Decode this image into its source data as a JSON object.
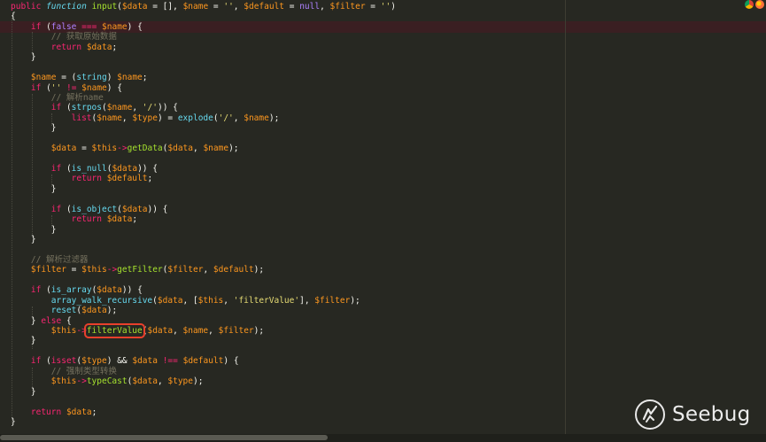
{
  "editor": {
    "theme": "monokai",
    "highlight_color": "#3a1f22",
    "annotation_color": "#e8402c",
    "lines": [
      [
        [
          "k",
          "public"
        ],
        [
          "p",
          " "
        ],
        [
          "st",
          "function"
        ],
        [
          "p",
          " "
        ],
        [
          "fn",
          "input"
        ],
        [
          "p",
          "("
        ],
        [
          "v",
          "$data"
        ],
        [
          "p",
          " = [], "
        ],
        [
          "v",
          "$name"
        ],
        [
          "p",
          " = "
        ],
        [
          "s",
          "''"
        ],
        [
          "p",
          ", "
        ],
        [
          "v",
          "$default"
        ],
        [
          "p",
          " = "
        ],
        [
          "cn",
          "null"
        ],
        [
          "p",
          ", "
        ],
        [
          "v",
          "$filter"
        ],
        [
          "p",
          " = "
        ],
        [
          "s",
          "''"
        ],
        [
          "p",
          ")"
        ]
      ],
      [
        [
          "p",
          "{"
        ]
      ],
      [
        [
          "p",
          "    "
        ],
        [
          "k",
          "if"
        ],
        [
          "p",
          " ("
        ],
        [
          "cn",
          "false"
        ],
        [
          "p",
          " "
        ],
        [
          "k",
          "==="
        ],
        [
          "p",
          " "
        ],
        [
          "v",
          "$name"
        ],
        [
          "p",
          ") {"
        ]
      ],
      [
        [
          "p",
          "        "
        ],
        [
          "c",
          "// 获取原始数据"
        ]
      ],
      [
        [
          "p",
          "        "
        ],
        [
          "k",
          "return"
        ],
        [
          "p",
          " "
        ],
        [
          "v",
          "$data"
        ],
        [
          "p",
          ";"
        ]
      ],
      [
        [
          "p",
          "    }"
        ]
      ],
      [
        [
          "p",
          ""
        ]
      ],
      [
        [
          "p",
          "    "
        ],
        [
          "v",
          "$name"
        ],
        [
          "p",
          " = ("
        ],
        [
          "bn",
          "string"
        ],
        [
          "p",
          ") "
        ],
        [
          "v",
          "$name"
        ],
        [
          "p",
          ";"
        ]
      ],
      [
        [
          "p",
          "    "
        ],
        [
          "k",
          "if"
        ],
        [
          "p",
          " ("
        ],
        [
          "s",
          "''"
        ],
        [
          "p",
          " "
        ],
        [
          "k",
          "!="
        ],
        [
          "p",
          " "
        ],
        [
          "v",
          "$name"
        ],
        [
          "p",
          ") {"
        ]
      ],
      [
        [
          "p",
          "        "
        ],
        [
          "c",
          "// 解析name"
        ]
      ],
      [
        [
          "p",
          "        "
        ],
        [
          "k",
          "if"
        ],
        [
          "p",
          " ("
        ],
        [
          "bn",
          "strpos"
        ],
        [
          "p",
          "("
        ],
        [
          "v",
          "$name"
        ],
        [
          "p",
          ", "
        ],
        [
          "s",
          "'/'"
        ],
        [
          "p",
          ")) {"
        ]
      ],
      [
        [
          "p",
          "            "
        ],
        [
          "k",
          "list"
        ],
        [
          "p",
          "("
        ],
        [
          "v",
          "$name"
        ],
        [
          "p",
          ", "
        ],
        [
          "v",
          "$type"
        ],
        [
          "p",
          ") = "
        ],
        [
          "bn",
          "explode"
        ],
        [
          "p",
          "("
        ],
        [
          "s",
          "'/'"
        ],
        [
          "p",
          ", "
        ],
        [
          "v",
          "$name"
        ],
        [
          "p",
          ");"
        ]
      ],
      [
        [
          "p",
          "        }"
        ]
      ],
      [
        [
          "p",
          ""
        ]
      ],
      [
        [
          "p",
          "        "
        ],
        [
          "v",
          "$data"
        ],
        [
          "p",
          " = "
        ],
        [
          "v",
          "$this"
        ],
        [
          "k",
          "->"
        ],
        [
          "fn",
          "getData"
        ],
        [
          "p",
          "("
        ],
        [
          "v",
          "$data"
        ],
        [
          "p",
          ", "
        ],
        [
          "v",
          "$name"
        ],
        [
          "p",
          ");"
        ]
      ],
      [
        [
          "p",
          ""
        ]
      ],
      [
        [
          "p",
          "        "
        ],
        [
          "k",
          "if"
        ],
        [
          "p",
          " ("
        ],
        [
          "bn",
          "is_null"
        ],
        [
          "p",
          "("
        ],
        [
          "v",
          "$data"
        ],
        [
          "p",
          ")) {"
        ]
      ],
      [
        [
          "p",
          "            "
        ],
        [
          "k",
          "return"
        ],
        [
          "p",
          " "
        ],
        [
          "v",
          "$default"
        ],
        [
          "p",
          ";"
        ]
      ],
      [
        [
          "p",
          "        }"
        ]
      ],
      [
        [
          "p",
          ""
        ]
      ],
      [
        [
          "p",
          "        "
        ],
        [
          "k",
          "if"
        ],
        [
          "p",
          " ("
        ],
        [
          "bn",
          "is_object"
        ],
        [
          "p",
          "("
        ],
        [
          "v",
          "$data"
        ],
        [
          "p",
          ")) {"
        ]
      ],
      [
        [
          "p",
          "            "
        ],
        [
          "k",
          "return"
        ],
        [
          "p",
          " "
        ],
        [
          "v",
          "$data"
        ],
        [
          "p",
          ";"
        ]
      ],
      [
        [
          "p",
          "        }"
        ]
      ],
      [
        [
          "p",
          "    }"
        ]
      ],
      [
        [
          "p",
          ""
        ]
      ],
      [
        [
          "p",
          "    "
        ],
        [
          "c",
          "// 解析过滤器"
        ]
      ],
      [
        [
          "p",
          "    "
        ],
        [
          "v",
          "$filter"
        ],
        [
          "p",
          " = "
        ],
        [
          "v",
          "$this"
        ],
        [
          "k",
          "->"
        ],
        [
          "fn",
          "getFilter"
        ],
        [
          "p",
          "("
        ],
        [
          "v",
          "$filter"
        ],
        [
          "p",
          ", "
        ],
        [
          "v",
          "$default"
        ],
        [
          "p",
          ");"
        ]
      ],
      [
        [
          "p",
          ""
        ]
      ],
      [
        [
          "p",
          "    "
        ],
        [
          "k",
          "if"
        ],
        [
          "p",
          " ("
        ],
        [
          "bn",
          "is_array"
        ],
        [
          "p",
          "("
        ],
        [
          "v",
          "$data"
        ],
        [
          "p",
          ")) {"
        ]
      ],
      [
        [
          "p",
          "        "
        ],
        [
          "bn",
          "array_walk_recursive"
        ],
        [
          "p",
          "("
        ],
        [
          "v",
          "$data"
        ],
        [
          "p",
          ", ["
        ],
        [
          "v",
          "$this"
        ],
        [
          "p",
          ", "
        ],
        [
          "s",
          "'filterValue'"
        ],
        [
          "p",
          "], "
        ],
        [
          "v",
          "$filter"
        ],
        [
          "p",
          ");"
        ]
      ],
      [
        [
          "p",
          "        "
        ],
        [
          "bn",
          "reset"
        ],
        [
          "p",
          "("
        ],
        [
          "v",
          "$data"
        ],
        [
          "p",
          ");"
        ]
      ],
      [
        [
          "p",
          "    } "
        ],
        [
          "k",
          "else"
        ],
        [
          "p",
          " {"
        ]
      ],
      [
        [
          "p",
          "        "
        ],
        [
          "v",
          "$this"
        ],
        [
          "k",
          "->"
        ],
        [
          "fnmark",
          "filterValue"
        ],
        [
          "p",
          "("
        ],
        [
          "v",
          "$data"
        ],
        [
          "p",
          ", "
        ],
        [
          "v",
          "$name"
        ],
        [
          "p",
          ", "
        ],
        [
          "v",
          "$filter"
        ],
        [
          "p",
          ");"
        ]
      ],
      [
        [
          "p",
          "    }"
        ]
      ],
      [
        [
          "p",
          ""
        ]
      ],
      [
        [
          "p",
          "    "
        ],
        [
          "k",
          "if"
        ],
        [
          "p",
          " ("
        ],
        [
          "k",
          "isset"
        ],
        [
          "p",
          "("
        ],
        [
          "v",
          "$type"
        ],
        [
          "p",
          ") && "
        ],
        [
          "v",
          "$data"
        ],
        [
          "p",
          " "
        ],
        [
          "k",
          "!=="
        ],
        [
          "p",
          " "
        ],
        [
          "v",
          "$default"
        ],
        [
          "p",
          ") {"
        ]
      ],
      [
        [
          "p",
          "        "
        ],
        [
          "c",
          "// 强制类型转换"
        ]
      ],
      [
        [
          "p",
          "        "
        ],
        [
          "v",
          "$this"
        ],
        [
          "k",
          "->"
        ],
        [
          "fn",
          "typeCast"
        ],
        [
          "p",
          "("
        ],
        [
          "v",
          "$data"
        ],
        [
          "p",
          ", "
        ],
        [
          "v",
          "$type"
        ],
        [
          "p",
          ");"
        ]
      ],
      [
        [
          "p",
          "    }"
        ]
      ],
      [
        [
          "p",
          ""
        ]
      ],
      [
        [
          "p",
          "    "
        ],
        [
          "k",
          "return"
        ],
        [
          "p",
          " "
        ],
        [
          "v",
          "$data"
        ],
        [
          "p",
          ";"
        ]
      ],
      [
        [
          "p",
          "}"
        ]
      ]
    ]
  },
  "toolbar": {
    "browser_icons": [
      "chrome-icon",
      "firefox-icon"
    ]
  },
  "watermark": {
    "text": "Seebug",
    "icon": "seebug-logo-icon"
  }
}
